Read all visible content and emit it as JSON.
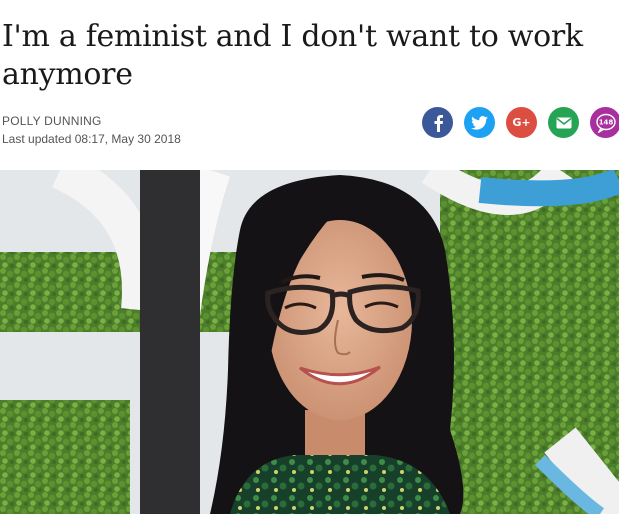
{
  "article": {
    "headline": "I'm a feminist and I don't want to work anymore",
    "author": "POLLY DUNNING",
    "updated": "Last updated 08:17, May 30 2018"
  },
  "share": {
    "facebook_icon": "facebook-icon",
    "twitter_icon": "twitter-icon",
    "googleplus_label": "G+",
    "email_icon": "email-icon",
    "comments_count": "148",
    "colors": {
      "facebook": "#3b5998",
      "twitter": "#1da1f2",
      "googleplus": "#dc4e41",
      "email": "#25a456",
      "comments": "#a82f9e"
    }
  },
  "photo": {
    "subject": "hero-photo"
  }
}
